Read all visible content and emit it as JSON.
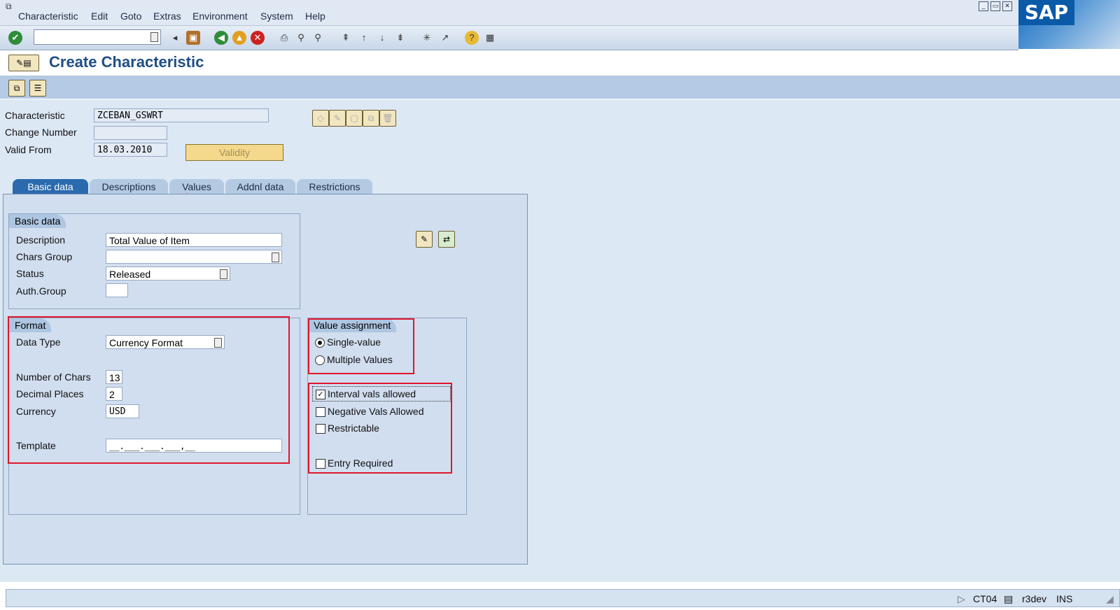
{
  "menubar": {
    "items": [
      "Characteristic",
      "Edit",
      "Goto",
      "Extras",
      "Environment",
      "System",
      "Help"
    ]
  },
  "brand": {
    "logo_text": "SAP"
  },
  "toolbar": {
    "command_field_value": ""
  },
  "title": {
    "text": "Create Characteristic"
  },
  "header_fields": {
    "characteristic_label": "Characteristic",
    "characteristic_value": "ZCEBAN_GSWRT",
    "change_number_label": "Change Number",
    "change_number_value": "",
    "valid_from_label": "Valid From",
    "valid_from_value": "18.03.2010",
    "validity_button": "Validity"
  },
  "tabs": [
    "Basic data",
    "Descriptions",
    "Values",
    "Addnl data",
    "Restrictions"
  ],
  "basic_data": {
    "group_title": "Basic data",
    "description_label": "Description",
    "description_value": "Total Value of Item",
    "chars_group_label": "Chars Group",
    "chars_group_value": "",
    "status_label": "Status",
    "status_value": "Released",
    "auth_group_label": "Auth.Group",
    "auth_group_value": ""
  },
  "format": {
    "group_title": "Format",
    "data_type_label": "Data Type",
    "data_type_value": "Currency Format",
    "num_chars_label": "Number of Chars",
    "num_chars_value": "13",
    "decimal_label": "Decimal Places",
    "decimal_value": "2",
    "currency_label": "Currency",
    "currency_value": "USD",
    "template_label": "Template",
    "template_value": "__.___.___.___,__"
  },
  "value_assignment": {
    "group_title": "Value assignment",
    "single_label": "Single-value",
    "multiple_label": "Multiple Values",
    "selected": "single"
  },
  "options": {
    "interval_label": "Interval vals allowed",
    "interval_checked": true,
    "negative_label": "Negative Vals Allowed",
    "negative_checked": false,
    "restrictable_label": "Restrictable",
    "restrictable_checked": false,
    "entry_required_label": "Entry Required",
    "entry_required_checked": false
  },
  "statusbar": {
    "transaction": "CT04",
    "system": "r3dev",
    "mode": "INS"
  },
  "colors": {
    "accent": "#2a6aad",
    "highlight": "#e0162b",
    "panel": "#d1deef"
  }
}
